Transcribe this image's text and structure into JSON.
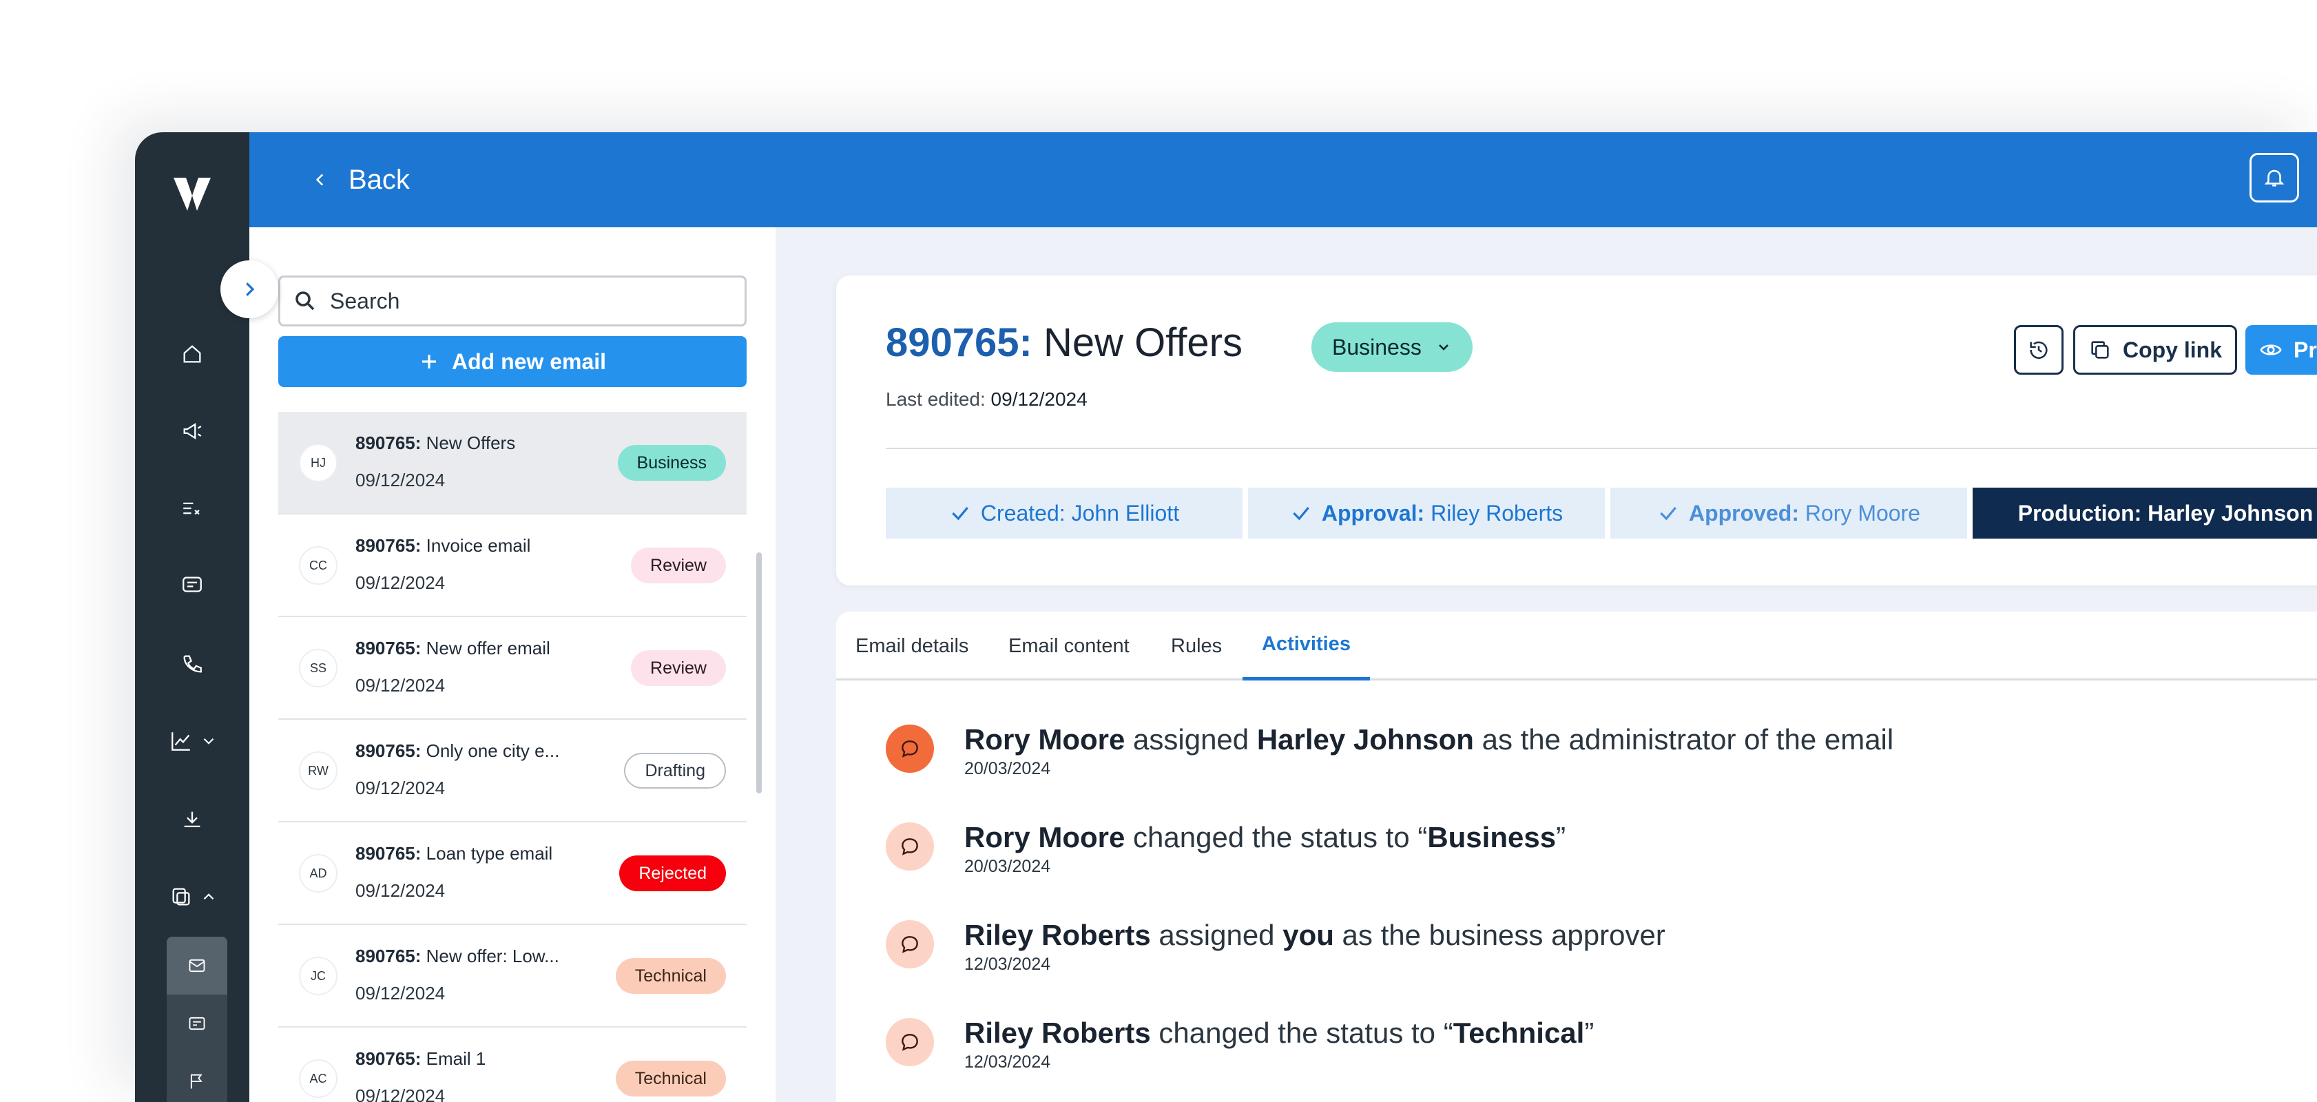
{
  "topbar": {
    "back_label": "Back",
    "notifications_icon": "bell-icon"
  },
  "sidebar": {
    "logo": "V",
    "items": [
      {
        "icon": "home-icon"
      },
      {
        "icon": "megaphone-icon"
      },
      {
        "icon": "checklist-icon"
      },
      {
        "icon": "message-icon"
      },
      {
        "icon": "phone-icon"
      },
      {
        "icon": "chart-icon"
      },
      {
        "icon": "download-icon"
      },
      {
        "icon": "templates-icon"
      }
    ],
    "subitems": [
      {
        "icon": "mail-icon"
      },
      {
        "icon": "card-icon"
      },
      {
        "icon": "flag-icon"
      }
    ]
  },
  "list": {
    "search_placeholder": "Search",
    "add_label": "Add new email",
    "emails": [
      {
        "initials": "HJ",
        "id": "890765:",
        "name": " New Offers",
        "date": "09/12/2024",
        "status": "Business"
      },
      {
        "initials": "CC",
        "id": "890765:",
        "name": " Invoice email",
        "date": "09/12/2024",
        "status": "Review"
      },
      {
        "initials": "SS",
        "id": "890765:",
        "name": " New offer email",
        "date": "09/12/2024",
        "status": "Review"
      },
      {
        "initials": "RW",
        "id": "890765:",
        "name": " Only one city e...",
        "date": "09/12/2024",
        "status": "Drafting"
      },
      {
        "initials": "AD",
        "id": "890765:",
        "name": " Loan type email",
        "date": "09/12/2024",
        "status": "Rejected"
      },
      {
        "initials": "JC",
        "id": "890765:",
        "name": " New offer: Low...",
        "date": "09/12/2024",
        "status": "Technical"
      },
      {
        "initials": "AC",
        "id": "890765:",
        "name": " Email 1",
        "date": "09/12/2024",
        "status": "Technical"
      }
    ]
  },
  "detail": {
    "id": "890765:",
    "name": " New Offers",
    "status": "Business",
    "last_edited_label": "Last edited:",
    "last_edited_value": " 09/12/2024",
    "history_icon": "history-icon",
    "copy_link_label": "Copy link",
    "preview_label": "Preview a test",
    "steps": [
      {
        "key": "Created:",
        "value": " John Elliott"
      },
      {
        "key": "Approval:",
        "value": " Riley Roberts"
      },
      {
        "key": "Approved:",
        "value": " Rory Moore"
      },
      {
        "key": "Production:",
        "value": " Harley Johnson"
      }
    ]
  },
  "tabs": [
    "Email details",
    "Email content",
    "Rules",
    "Activities"
  ],
  "activities": [
    {
      "a": "Rory Moore",
      "b": " assigned ",
      "c": "Harley Johnson",
      "d": " as the administrator of the email",
      "date": "20/03/2024"
    },
    {
      "a": "Rory Moore",
      "b": " changed the status to “",
      "c": "Business",
      "d": "”",
      "date": "20/03/2024"
    },
    {
      "a": "Riley Roberts",
      "b": " assigned ",
      "c": "you",
      "d": " as the business approver",
      "date": "12/03/2024"
    },
    {
      "a": "Riley Roberts",
      "b": " changed the status to “",
      "c": "Technical",
      "d": "”",
      "date": "12/03/2024"
    }
  ],
  "colors": {
    "brand_blue": "#1c76d2",
    "rail": "#23303a",
    "business": "#86e3d4",
    "review": "#fde2ec",
    "rejected": "#f5000c",
    "technical": "#fbcdb9",
    "production": "#0f2b4f"
  }
}
